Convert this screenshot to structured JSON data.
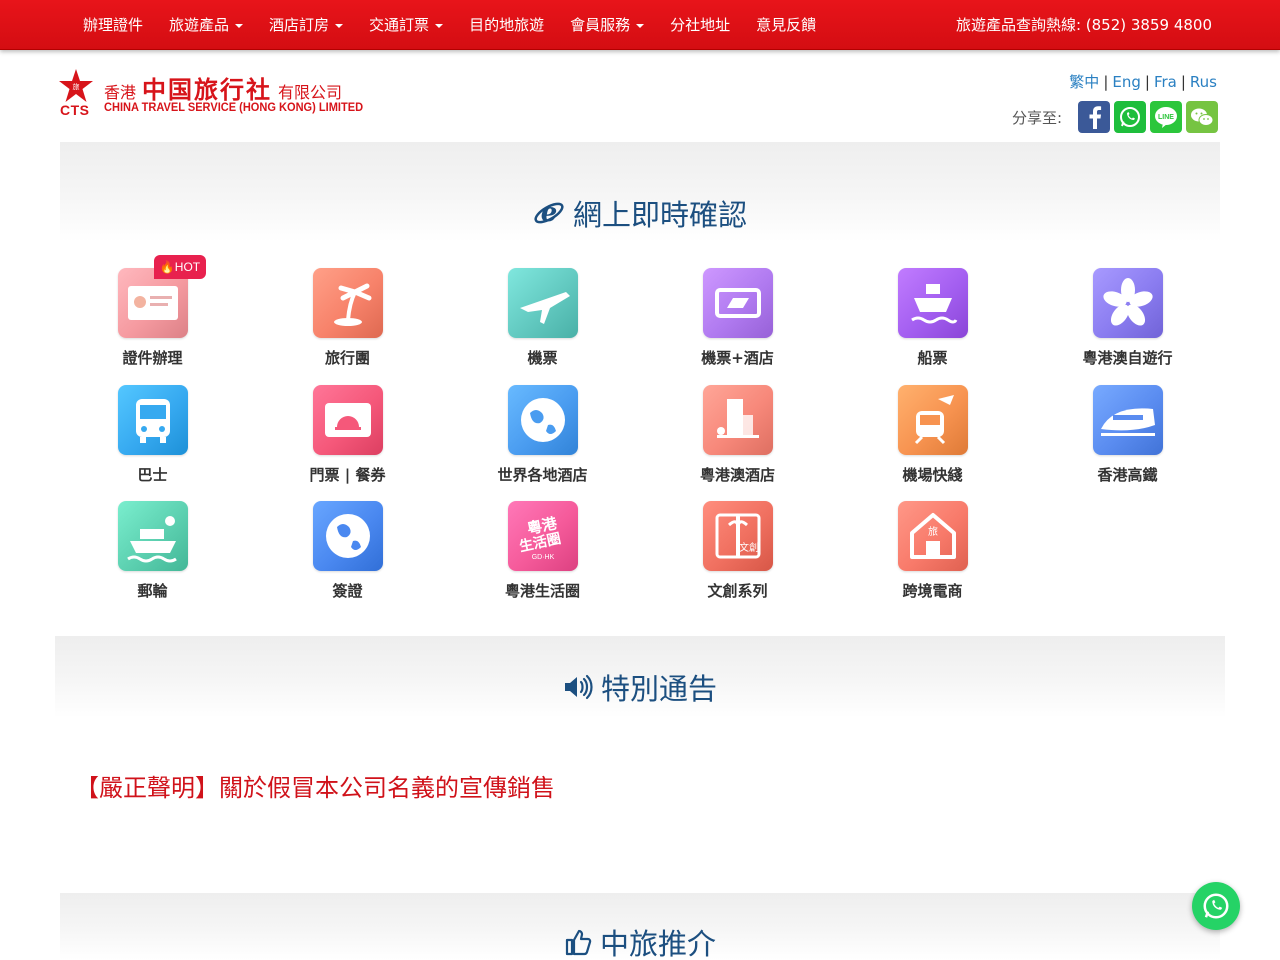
{
  "nav": {
    "items": [
      {
        "label": "辦理證件",
        "dropdown": false
      },
      {
        "label": "旅遊產品",
        "dropdown": true
      },
      {
        "label": "酒店訂房",
        "dropdown": true
      },
      {
        "label": "交通訂票",
        "dropdown": true
      },
      {
        "label": "目的地旅遊",
        "dropdown": false
      },
      {
        "label": "會員服務",
        "dropdown": true
      },
      {
        "label": "分社地址",
        "dropdown": false
      },
      {
        "label": "意見反饋",
        "dropdown": false
      }
    ],
    "hotline": "旅遊產品查詢熱線: (852) 3859 4800"
  },
  "logo": {
    "cts": "CTS",
    "cn_prefix": "香港",
    "cn_name": "中国旅行社",
    "cn_suffix": "有限公司",
    "en_name": "CHINA TRAVEL SERVICE (HONG KONG) LIMITED"
  },
  "languages": [
    "繁中",
    "Eng",
    "Fra",
    "Rus"
  ],
  "share": {
    "label": "分享至:",
    "icons": [
      "facebook-icon",
      "whatsapp-icon",
      "line-icon",
      "wechat-icon"
    ]
  },
  "sections": {
    "online": "網上即時確認",
    "notice": "特別通告",
    "recommend": "中旅推介"
  },
  "hot_badge": "HOT",
  "services": [
    {
      "label": "證件辦理",
      "icon": "id-card-icon",
      "color": "#f59aa0"
    },
    {
      "label": "旅行團",
      "icon": "palm-beach-icon",
      "color": "#f7826a"
    },
    {
      "label": "機票",
      "icon": "airplane-icon",
      "color": "#62c9c0"
    },
    {
      "label": "機票+酒店",
      "icon": "ticket-icon",
      "color": "#b07af0"
    },
    {
      "label": "船票",
      "icon": "ship-icon",
      "color": "#a35ef0"
    },
    {
      "label": "粵港澳自遊行",
      "icon": "bauhinia-icon",
      "color": "#8a7cf0"
    },
    {
      "label": "巴士",
      "icon": "bus-icon",
      "color": "#36a9f0"
    },
    {
      "label": "門票 | 餐券",
      "icon": "dining-ticket-icon",
      "color": "#f5587a"
    },
    {
      "label": "世界各地酒店",
      "icon": "globe-icon",
      "color": "#4a9cf0"
    },
    {
      "label": "粵港澳酒店",
      "icon": "hotel-building-icon",
      "color": "#f7887a"
    },
    {
      "label": "機場快綫",
      "icon": "airport-train-icon",
      "color": "#f79350"
    },
    {
      "label": "香港高鐵",
      "icon": "high-speed-train-icon",
      "color": "#5a8cf0"
    },
    {
      "label": "郵輪",
      "icon": "cruise-icon",
      "color": "#5cd0b0"
    },
    {
      "label": "簽證",
      "icon": "visa-globe-icon",
      "color": "#4a88f0"
    },
    {
      "label": "粵港生活圈",
      "icon": "gd-hk-logo-icon",
      "color": "#f55a9a"
    },
    {
      "label": "文創系列",
      "icon": "gift-box-icon",
      "color": "#f07060"
    },
    {
      "label": "跨境電商",
      "icon": "shop-house-icon",
      "color": "#f87a6a"
    }
  ],
  "notice_link": "【嚴正聲明】關於假冒本公司名義的宣傳銷售"
}
